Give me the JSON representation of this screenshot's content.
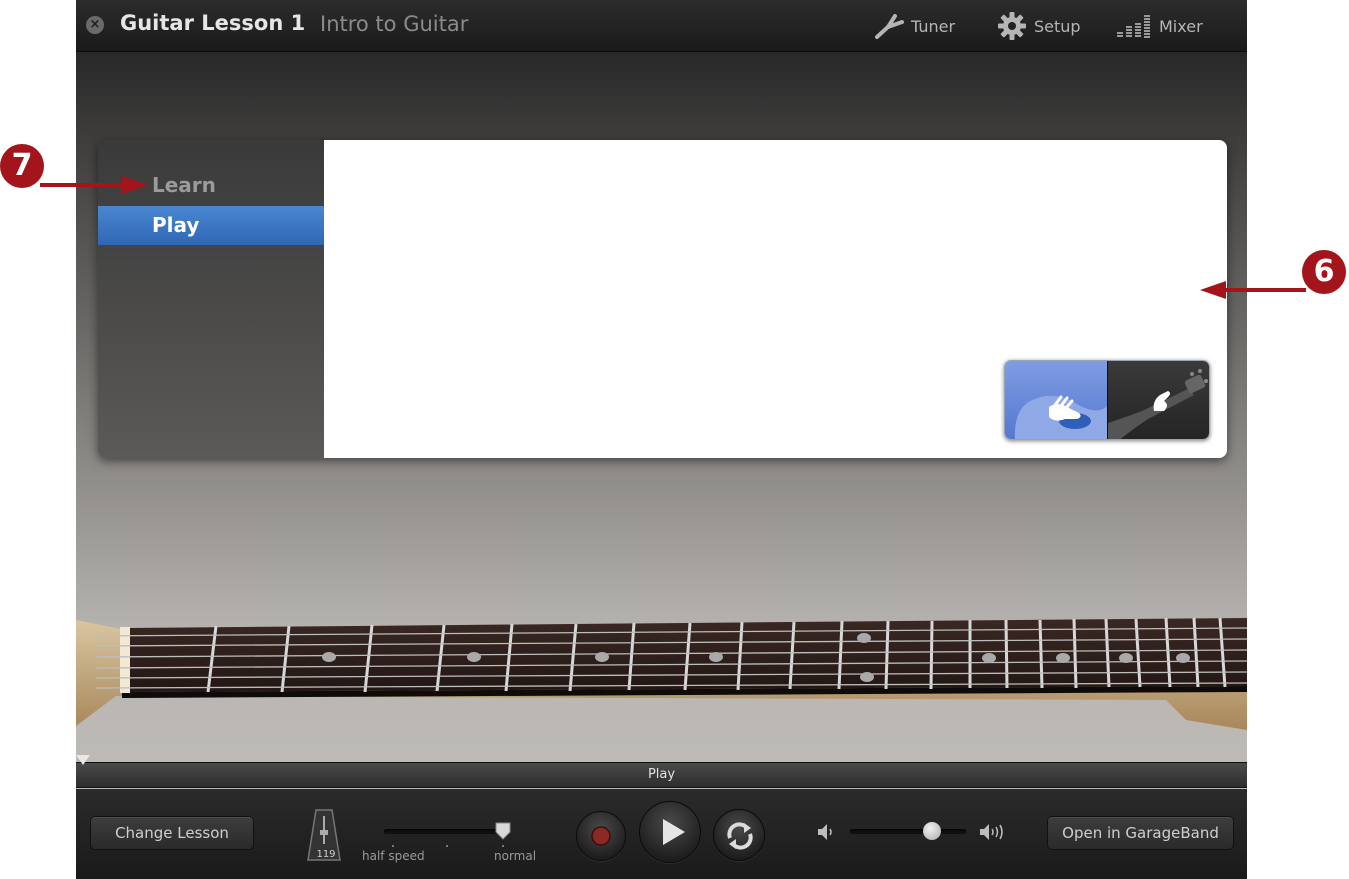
{
  "titlebar": {
    "title": "Guitar Lesson 1",
    "subtitle": "Intro to Guitar",
    "close_icon": "close-icon",
    "tools": [
      {
        "label": "Tuner",
        "icon": "tuning-fork-icon"
      },
      {
        "label": "Setup",
        "icon": "gear-icon"
      },
      {
        "label": "Mixer",
        "icon": "mixer-bars-icon"
      }
    ]
  },
  "lesson_panel": {
    "sidebar": [
      {
        "label": "Learn",
        "selected": false
      },
      {
        "label": "Play",
        "selected": true
      }
    ],
    "view_toggle": {
      "options": [
        "hand-view-icon",
        "guitar-view-icon"
      ],
      "selected": "hand-view-icon"
    }
  },
  "play_strip": {
    "label": "Play"
  },
  "controls": {
    "change_lesson": "Change Lesson",
    "tempo": "119",
    "speed_labels": {
      "min": "half speed",
      "max": "normal"
    },
    "speed_level": 1.0,
    "volume_level": 0.7,
    "open_in": "Open in GarageBand"
  },
  "callouts": [
    "7",
    "6"
  ],
  "colors": {
    "accent_blue": "#3a74c2",
    "callout_red": "#a3151b",
    "record_red": "#8a2a22"
  }
}
